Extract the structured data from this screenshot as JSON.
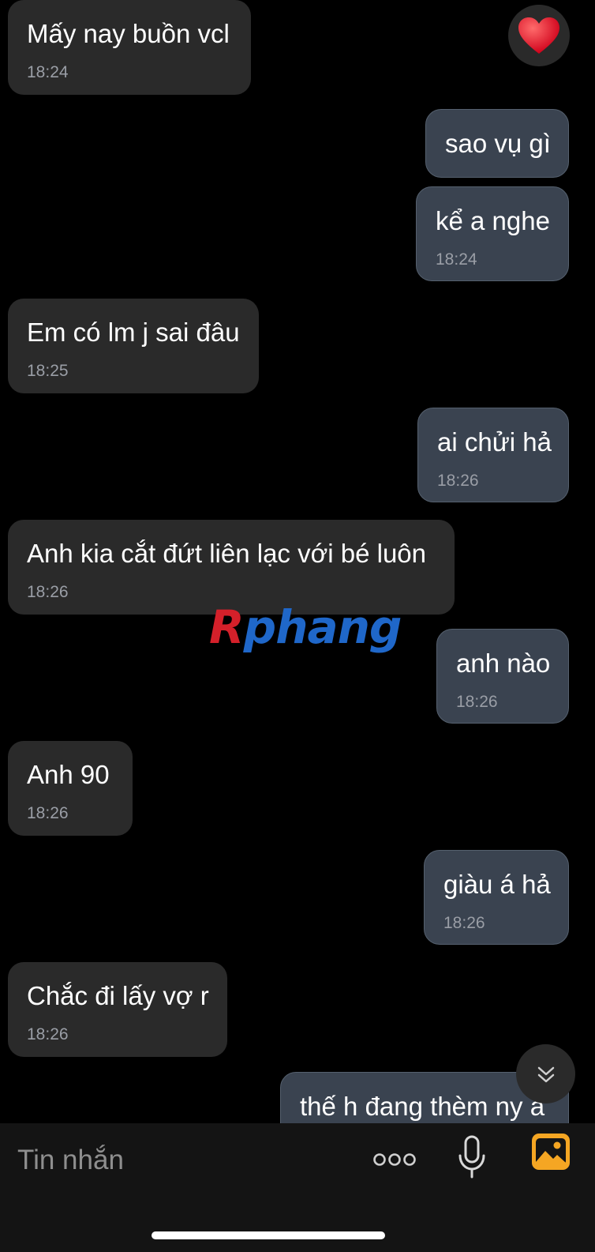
{
  "messages": [
    {
      "side": "in",
      "text": "Mấy nay buồn vcl",
      "time": "18:24"
    },
    {
      "side": "out",
      "text": "sao vụ gì",
      "time": ""
    },
    {
      "side": "out",
      "text": "kể a nghe",
      "time": "18:24"
    },
    {
      "side": "in",
      "text": "Em có lm j sai đâu",
      "time": "18:25"
    },
    {
      "side": "out",
      "text": "ai chửi hả",
      "time": "18:26"
    },
    {
      "side": "in",
      "text": "Anh kia cắt đứt liên lạc với bé luôn",
      "time": "18:26"
    },
    {
      "side": "out",
      "text": "anh nào",
      "time": "18:26"
    },
    {
      "side": "in",
      "text": "Anh 90",
      "time": "18:26"
    },
    {
      "side": "out",
      "text": "giàu á hả",
      "time": "18:26"
    },
    {
      "side": "in",
      "text": "Chắc đi lấy vợ r",
      "time": "18:26"
    },
    {
      "side": "out",
      "text": "thế h đang thèm ny à",
      "time": ""
    }
  ],
  "watermark": {
    "first": "R",
    "rest": "phang"
  },
  "composer": {
    "placeholder": "Tin nhắn"
  },
  "icons": {
    "reaction": "heart-icon",
    "scroll": "double-chevron-down-icon",
    "more": "more-dots-icon",
    "mic": "microphone-icon",
    "image": "image-icon"
  },
  "colors": {
    "incoming": "#2a2a2a",
    "outgoing": "#3a4350",
    "background": "#000000",
    "accent": "#f5a623"
  }
}
